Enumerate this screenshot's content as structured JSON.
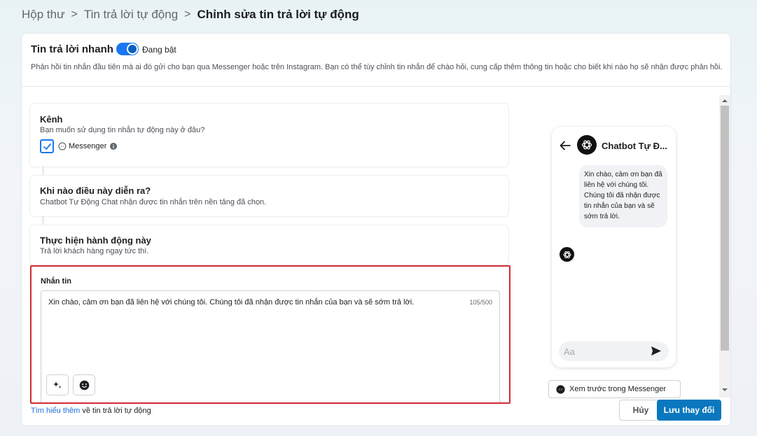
{
  "breadcrumb": {
    "items": [
      "Hộp thư",
      "Tin trả lời tự động"
    ],
    "current": "Chỉnh sửa tin trả lời tự động"
  },
  "header": {
    "title": "Tin trả lời nhanh",
    "toggle_label": "Đang bật",
    "toggle_on": true,
    "description": "Phản hồi tin nhắn đầu tiên mà ai đó gửi cho bạn qua Messenger hoặc trên Instagram. Bạn có thể tùy chỉnh tin nhắn để chào hỏi, cung cấp thêm thông tin hoặc cho biết khi nào họ sẽ nhận được phản hồi."
  },
  "channel": {
    "title": "Kênh",
    "subtitle": "Bạn muốn sử dụng tin nhắn tự động này ở đâu?",
    "messenger_label": "Messenger",
    "checked": true
  },
  "trigger": {
    "title": "Khi nào điều này diễn ra?",
    "subtitle": "Chatbot Tự Động Chat nhận được tin nhắn trên nền tảng đã chọn."
  },
  "action": {
    "title": "Thực hiện hành động này",
    "subtitle": "Trả lời khách hàng ngay tức thì."
  },
  "message": {
    "title": "Nhắn tin",
    "text": "Xin chào, cảm ơn bạn đã liên hệ với chúng tôi. Chúng tôi đã nhận được tin nhắn của bạn và sẽ sớm trả lời.",
    "count": "105/500"
  },
  "footer": {
    "learn_link": "Tìm hiểu thêm",
    "learn_rest": " về tin trả lời tự động",
    "cancel": "Hủy",
    "save": "Lưu thay đổi"
  },
  "preview": {
    "name": "Chatbot Tự Đ...",
    "bubble": "Xin chào, cảm ơn bạn đã liên hệ với chúng tôi. Chúng tôi đã nhận được tin nhắn của bạn và sẽ sớm trả lời.",
    "input_placeholder": "Aa",
    "preview_button": "Xem trước trong Messenger"
  },
  "colors": {
    "accent": "#1877f2",
    "save_button": "#0a78be",
    "highlight_border": "#d32a35"
  }
}
